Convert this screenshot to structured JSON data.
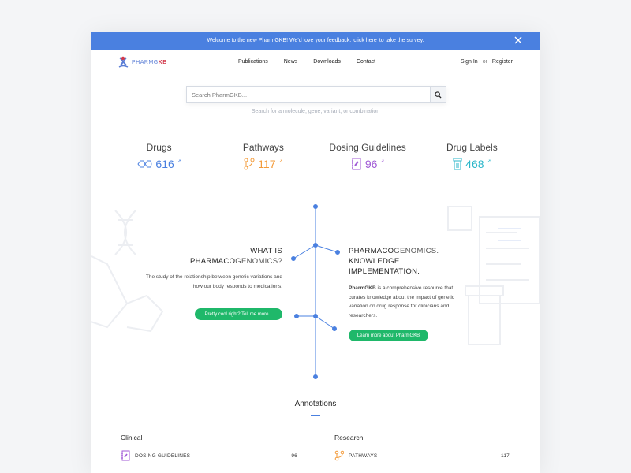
{
  "banner": {
    "text_before": "Welcome to the new PharmGKB! We'd love your feedback:",
    "link": "click here",
    "text_after": "to take the survey."
  },
  "logo": {
    "prefix": "PHARMG",
    "suffix": "KB"
  },
  "nav": {
    "items": [
      "Publications",
      "News",
      "Downloads",
      "Contact"
    ]
  },
  "auth": {
    "sign_in": "Sign In",
    "or": "or",
    "register": "Register"
  },
  "search": {
    "placeholder": "Search PharmGKB...",
    "hint": "Search for a molecule, gene, variant, or combination"
  },
  "stats": [
    {
      "label": "Drugs",
      "value": "616",
      "color": "#4a80e0",
      "icon": "molecule-icon"
    },
    {
      "label": "Pathways",
      "value": "117",
      "color": "#f39b3a",
      "icon": "pathway-icon"
    },
    {
      "label": "Dosing Guidelines",
      "value": "96",
      "color": "#a05ad6",
      "icon": "guideline-icon"
    },
    {
      "label": "Drug Labels",
      "value": "468",
      "color": "#2ab6c9",
      "icon": "pill-bottle-icon"
    }
  ],
  "what": {
    "line1": "WHAT IS",
    "line2_bold": "PHARMACO",
    "line2_thin": "GENOMICS?",
    "body": "The study of the relationship between genetic variations and how our body responds to medications.",
    "button": "Pretty cool right? Tell me more..."
  },
  "pg": {
    "line1_bold": "PHARMACO",
    "line1_thin": "GENOMICS.",
    "line2": "KNOWLEDGE.",
    "line3": "IMPLEMENTATION.",
    "body_bold": "PharmGKB",
    "body": " is a comprehensive resource that curates knowledge about the impact of genetic variation on drug response for clinicians and researchers.",
    "button": "Learn more about PharmGKB"
  },
  "annotations": {
    "title": "Annotations",
    "clinical": {
      "heading": "Clinical",
      "row_label": "DOSING GUIDELINES",
      "row_count": "96"
    },
    "research": {
      "heading": "Research",
      "row_label": "PATHWAYS",
      "row_count": "117"
    }
  },
  "colors": {
    "accent": "#4a80e0",
    "green": "#1fb86a"
  }
}
